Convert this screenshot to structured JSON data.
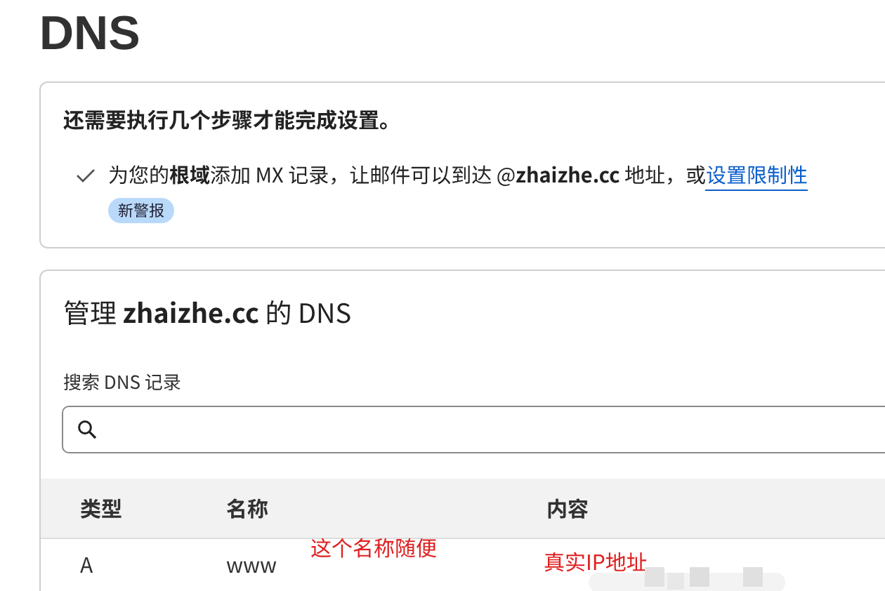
{
  "page_title": "DNS",
  "setup_card": {
    "heading": "还需要执行几个步骤才能完成设置。",
    "steps": [
      {
        "done": true,
        "text": "为您的**根域**添加 MX 记录，让邮件可以到达 @**zhaizhe.cc** 地址，或",
        "link": "设置限制性",
        "badge": "新警报"
      }
    ]
  },
  "dns_card": {
    "title": "管理 **zhaizhe.cc** 的 DNS",
    "search_label": "搜索 DNS 记录",
    "table": {
      "columns": [
        "类型",
        "名称",
        "内容"
      ],
      "rows": [
        {
          "cells": [
            "A",
            "www",
            ""
          ],
          "annotations": [
            "这个名称随便",
            "真实IP地址"
          ]
        }
      ]
    }
  }
}
